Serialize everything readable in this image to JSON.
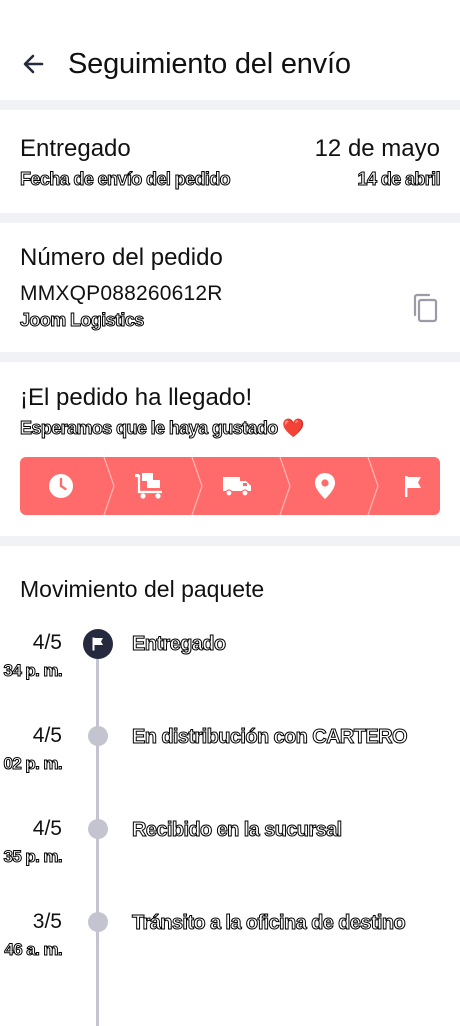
{
  "header": {
    "title": "Seguimiento del envío"
  },
  "delivery": {
    "status": "Entregado",
    "date": "12 de mayo",
    "ship_label": "Fecha de envío del pedido",
    "ship_date": "14 de abril"
  },
  "order": {
    "title": "Número del pedido",
    "number": "MMXQP088260612R",
    "carrier": "Joom Logistics"
  },
  "arrival": {
    "title": "¡El pedido ha llegado!",
    "subtitle": "Esperamos que le haya gustado ❤️",
    "steps": [
      "clock-icon",
      "cart-icon",
      "truck-icon",
      "location-pin-icon",
      "flag-icon"
    ],
    "progress_color": "#ff6b6b"
  },
  "movement": {
    "title": "Movimiento del paquete",
    "events": [
      {
        "date": "4/5",
        "time": "34 p. m.",
        "label": "Entregado"
      },
      {
        "date": "4/5",
        "time": "02 p. m.",
        "label": "En distribución con CARTERO"
      },
      {
        "date": "4/5",
        "time": "35 p. m.",
        "label": "Recibido en la sucursal"
      },
      {
        "date": "3/5",
        "time": "46 a. m.",
        "label": "Tránsito a la oficina de destino"
      }
    ]
  }
}
